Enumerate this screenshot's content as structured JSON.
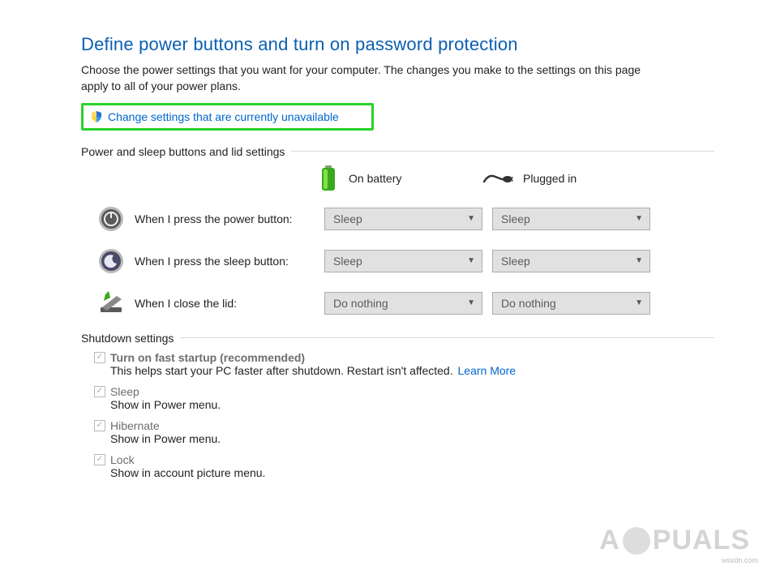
{
  "header": {
    "title": "Define power buttons and turn on password protection",
    "description": "Choose the power settings that you want for your computer. The changes you make to the settings on this page apply to all of your power plans.",
    "elevate_link": "Change settings that are currently unavailable"
  },
  "sections": {
    "buttons_lid": "Power and sleep buttons and lid settings",
    "shutdown": "Shutdown settings"
  },
  "columns": {
    "battery": "On battery",
    "plugged": "Plugged in"
  },
  "rows": [
    {
      "label": "When I press the power button:",
      "battery": "Sleep",
      "plugged": "Sleep"
    },
    {
      "label": "When I press the sleep button:",
      "battery": "Sleep",
      "plugged": "Sleep"
    },
    {
      "label": "When I close the lid:",
      "battery": "Do nothing",
      "plugged": "Do nothing"
    }
  ],
  "shutdown_items": [
    {
      "title": "Turn on fast startup (recommended)",
      "desc": "This helps start your PC faster after shutdown. Restart isn't affected.",
      "link": "Learn More",
      "bold": true
    },
    {
      "title": "Sleep",
      "desc": "Show in Power menu."
    },
    {
      "title": "Hibernate",
      "desc": "Show in Power menu."
    },
    {
      "title": "Lock",
      "desc": "Show in account picture menu."
    }
  ],
  "watermark": {
    "prefix": "A",
    "suffix": "PUALS"
  },
  "credit": "wsxdn.com"
}
